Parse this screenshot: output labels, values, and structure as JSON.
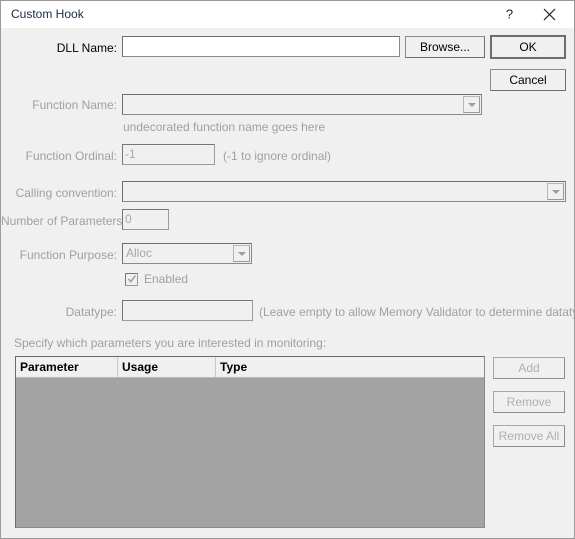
{
  "window": {
    "title": "Custom Hook",
    "help_button": "?",
    "close_button": "✕"
  },
  "form": {
    "dll_name": {
      "label": "DLL Name:",
      "value": "",
      "placeholder": ""
    },
    "function_name": {
      "label": "Function Name:",
      "value": "",
      "hint": "undecorated function name goes here",
      "enabled": false
    },
    "function_ordinal": {
      "label": "Function Ordinal:",
      "value": "-1",
      "hint": "(-1 to ignore ordinal)",
      "enabled": false
    },
    "calling_convention": {
      "label": "Calling convention:",
      "value": "",
      "enabled": false
    },
    "number_of_parameters": {
      "label": "Number of Parameters:",
      "value": "0",
      "enabled": false
    },
    "function_purpose": {
      "label": "Function Purpose:",
      "value": "Alloc",
      "enabled": false
    },
    "enabled_checkbox": {
      "label": "Enabled",
      "checked": true,
      "enabled": false
    },
    "datatype": {
      "label": "Datatype:",
      "value": "",
      "hint": "(Leave empty to allow Memory Validator to determine datatype)",
      "enabled": false
    }
  },
  "parameters_section": {
    "instruction": "Specify which parameters you are interested in monitoring:",
    "columns": [
      "Parameter",
      "Usage",
      "Type"
    ],
    "rows": []
  },
  "buttons": {
    "browse": "Browse...",
    "ok": "OK",
    "cancel": "Cancel",
    "add": "Add",
    "remove": "Remove",
    "remove_all": "Remove All"
  },
  "colors": {
    "dialog_background": "#f0f0f0",
    "titlebar_background": "#ffffff",
    "title_text": "#1b2a44",
    "disabled_text": "#a0a0a0",
    "enabled_text": "#000000",
    "list_body": "#a3a3a3",
    "input_background": "#ffffff"
  }
}
